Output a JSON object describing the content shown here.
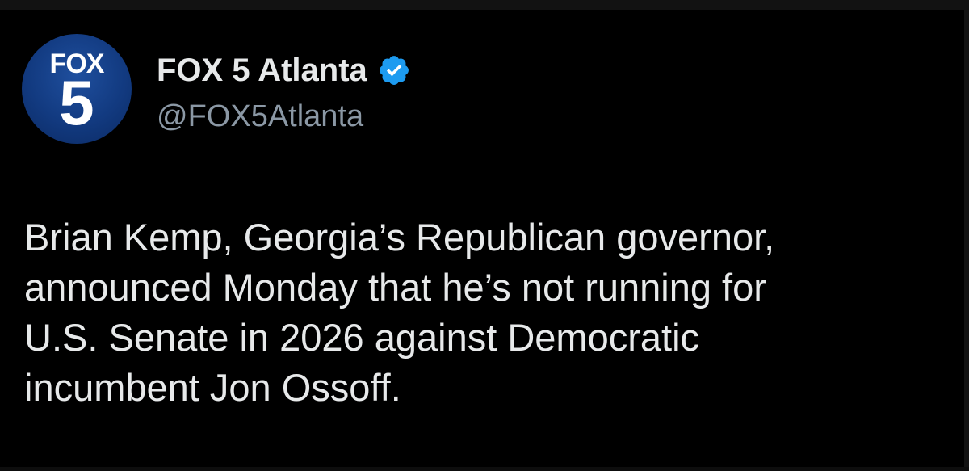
{
  "tweet": {
    "author": {
      "avatar": {
        "brand_line": "FOX",
        "channel_number": "5",
        "background_color": "#123a80"
      },
      "display_name": "FOX 5 Atlanta",
      "verified_badge": "verified-check-icon",
      "verified_color": "#1d9bf0",
      "handle": "@FOX5Atlanta"
    },
    "text": "Brian Kemp, Georgia’s Republican governor,\nannounced Monday that he’s not running for\nU.S. Senate in 2026 against Democratic\nincumbent Jon Ossoff."
  },
  "colors": {
    "background": "#000000",
    "primary_text": "#e7e9ea",
    "secondary_text": "#8b98a5"
  }
}
